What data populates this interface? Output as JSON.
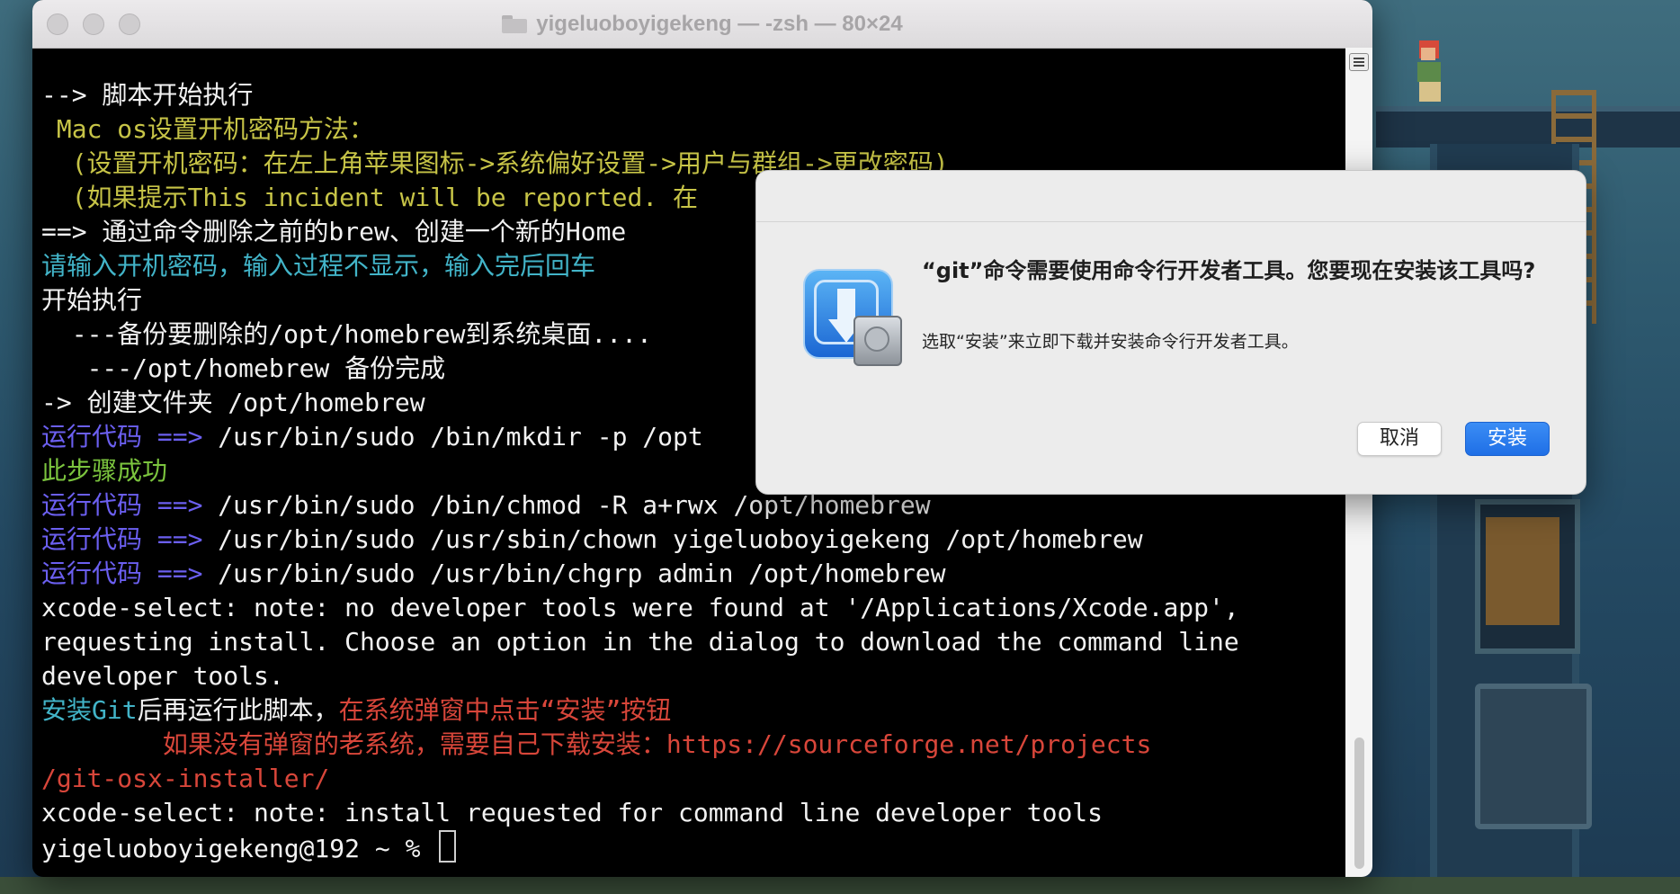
{
  "window": {
    "title": "yigeluoboyigekeng — -zsh — 80×24"
  },
  "terminal": {
    "lines": [
      [
        {
          "t": "--> 脚本开始执行",
          "c": "white"
        }
      ],
      [
        {
          "t": " Mac os设置开机密码方法：",
          "c": "yellow"
        }
      ],
      [
        {
          "t": "  (设置开机密码：在左上角苹果图标->系统偏好设置->用户与群组->更改密码)",
          "c": "yellow"
        }
      ],
      [
        {
          "t": "  (如果提示This incident will be reported. 在",
          "c": "yellow"
        }
      ],
      [
        {
          "t": "==> 通过命令删除之前的brew、创建一个新的Home",
          "c": "white"
        }
      ],
      [
        {
          "t": "请输入开机密码，输入过程不显示，输入完后回车",
          "c": "cyan"
        }
      ],
      [
        {
          "t": "开始执行",
          "c": "white"
        }
      ],
      [
        {
          "t": "  ---备份要删除的/opt/homebrew到系统桌面....",
          "c": "white"
        }
      ],
      [
        {
          "t": "   ---/opt/homebrew 备份完成",
          "c": "white"
        }
      ],
      [
        {
          "t": "-> 创建文件夹 /opt/homebrew",
          "c": "white"
        }
      ],
      [
        {
          "t": "运行代码 ==> ",
          "c": "blue"
        },
        {
          "t": "/usr/bin/sudo /bin/mkdir -p /opt",
          "c": "white"
        }
      ],
      [
        {
          "t": "此步骤成功",
          "c": "green"
        }
      ],
      [
        {
          "t": "运行代码 ==> ",
          "c": "blue"
        },
        {
          "t": "/usr/bin/sudo /bin/chmod -R a+rwx /opt/homebrew",
          "c": "white"
        }
      ],
      [
        {
          "t": "运行代码 ==> ",
          "c": "blue"
        },
        {
          "t": "/usr/bin/sudo /usr/sbin/chown yigeluoboyigekeng /opt/homebrew",
          "c": "white"
        }
      ],
      [
        {
          "t": "运行代码 ==> ",
          "c": "blue"
        },
        {
          "t": "/usr/bin/sudo /usr/bin/chgrp admin /opt/homebrew",
          "c": "white"
        }
      ],
      [
        {
          "t": "xcode-select: note: no developer tools were found at '/Applications/Xcode.app',",
          "c": "white"
        }
      ],
      [
        {
          "t": "requesting install. Choose an option in the dialog to download the command line",
          "c": "white"
        }
      ],
      [
        {
          "t": "developer tools.",
          "c": "white"
        }
      ],
      [
        {
          "t": "安装Git",
          "c": "cyan"
        },
        {
          "t": "后再运行此脚本，",
          "c": "white"
        },
        {
          "t": "在系统弹窗中点击“安装”按钮",
          "c": "red"
        }
      ],
      [
        {
          "t": "        如果没有弹窗的老系统，需要自己下载安装：https://sourceforge.net/projects",
          "c": "red"
        }
      ],
      [
        {
          "t": "/git-osx-installer/",
          "c": "red"
        }
      ],
      [
        {
          "t": "xcode-select: note: install requested for command line developer tools",
          "c": "white"
        }
      ]
    ],
    "prompt": "yigeluoboyigekeng@192 ~ % "
  },
  "dialog": {
    "title": "“git”命令需要使用命令行开发者工具。您要现在安装该工具吗?",
    "message": "选取“安装”来立即下载并安装命令行开发者工具。",
    "cancel_label": "取消",
    "install_label": "安装",
    "icon": "installer-icon"
  },
  "colors": {
    "white": "#f2f2f2",
    "yellow": "#c7c447",
    "cyan": "#42b4c8",
    "blue": "#6b5ff0",
    "green": "#7bc43e",
    "red": "#d8463a",
    "accent": "#1f6fe6"
  }
}
